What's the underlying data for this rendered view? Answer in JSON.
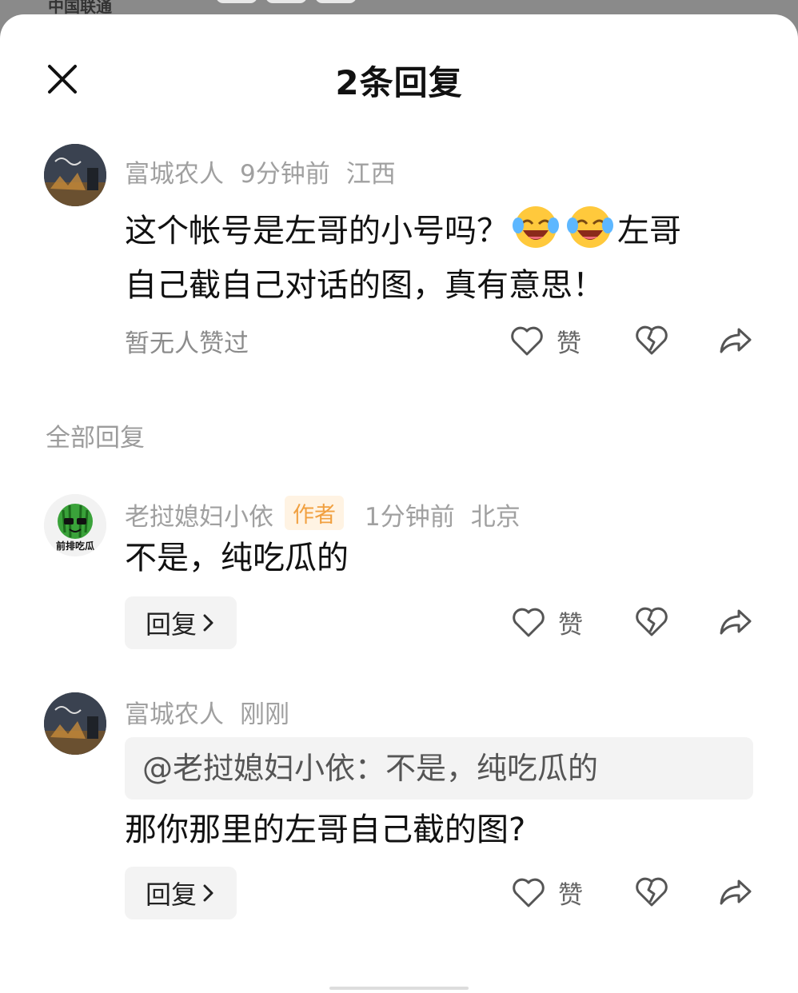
{
  "status_bar": {
    "carrier": "中国联通"
  },
  "header": {
    "title": "2条回复"
  },
  "main_comment": {
    "username": "富城农人",
    "time": "9分钟前",
    "location": "江西",
    "text_line1": "这个帐号是左哥的小号吗？",
    "text_line1_tail": "左哥",
    "text_line2": "自己截自己对话的图，真有意思！",
    "emoji": "laughing-crying-emoji",
    "likes_text": "暂无人赞过",
    "like_label": "赞"
  },
  "section_title": "全部回复",
  "replies": [
    {
      "username": "老挝媳妇小依",
      "badge": "作者",
      "time": "1分钟前",
      "location": "北京",
      "avatar_text": "前排吃瓜",
      "text": "不是，纯吃瓜的",
      "reply_label": "回复",
      "like_label": "赞"
    },
    {
      "username": "富城农人",
      "time": "刚刚",
      "quote": "@老挝媳妇小依：不是，纯吃瓜的",
      "text": "那你那里的左哥自己截的图?",
      "reply_label": "回复",
      "like_label": "赞"
    }
  ],
  "icons": {
    "close": "close-icon",
    "like": "heart-icon",
    "dislike": "broken-heart-icon",
    "share": "share-icon",
    "chevron": "chevron-right-icon"
  },
  "colors": {
    "badge_bg": "#fff3e3",
    "badge_text": "#f1a040",
    "meta_text": "#a0a0a0"
  }
}
